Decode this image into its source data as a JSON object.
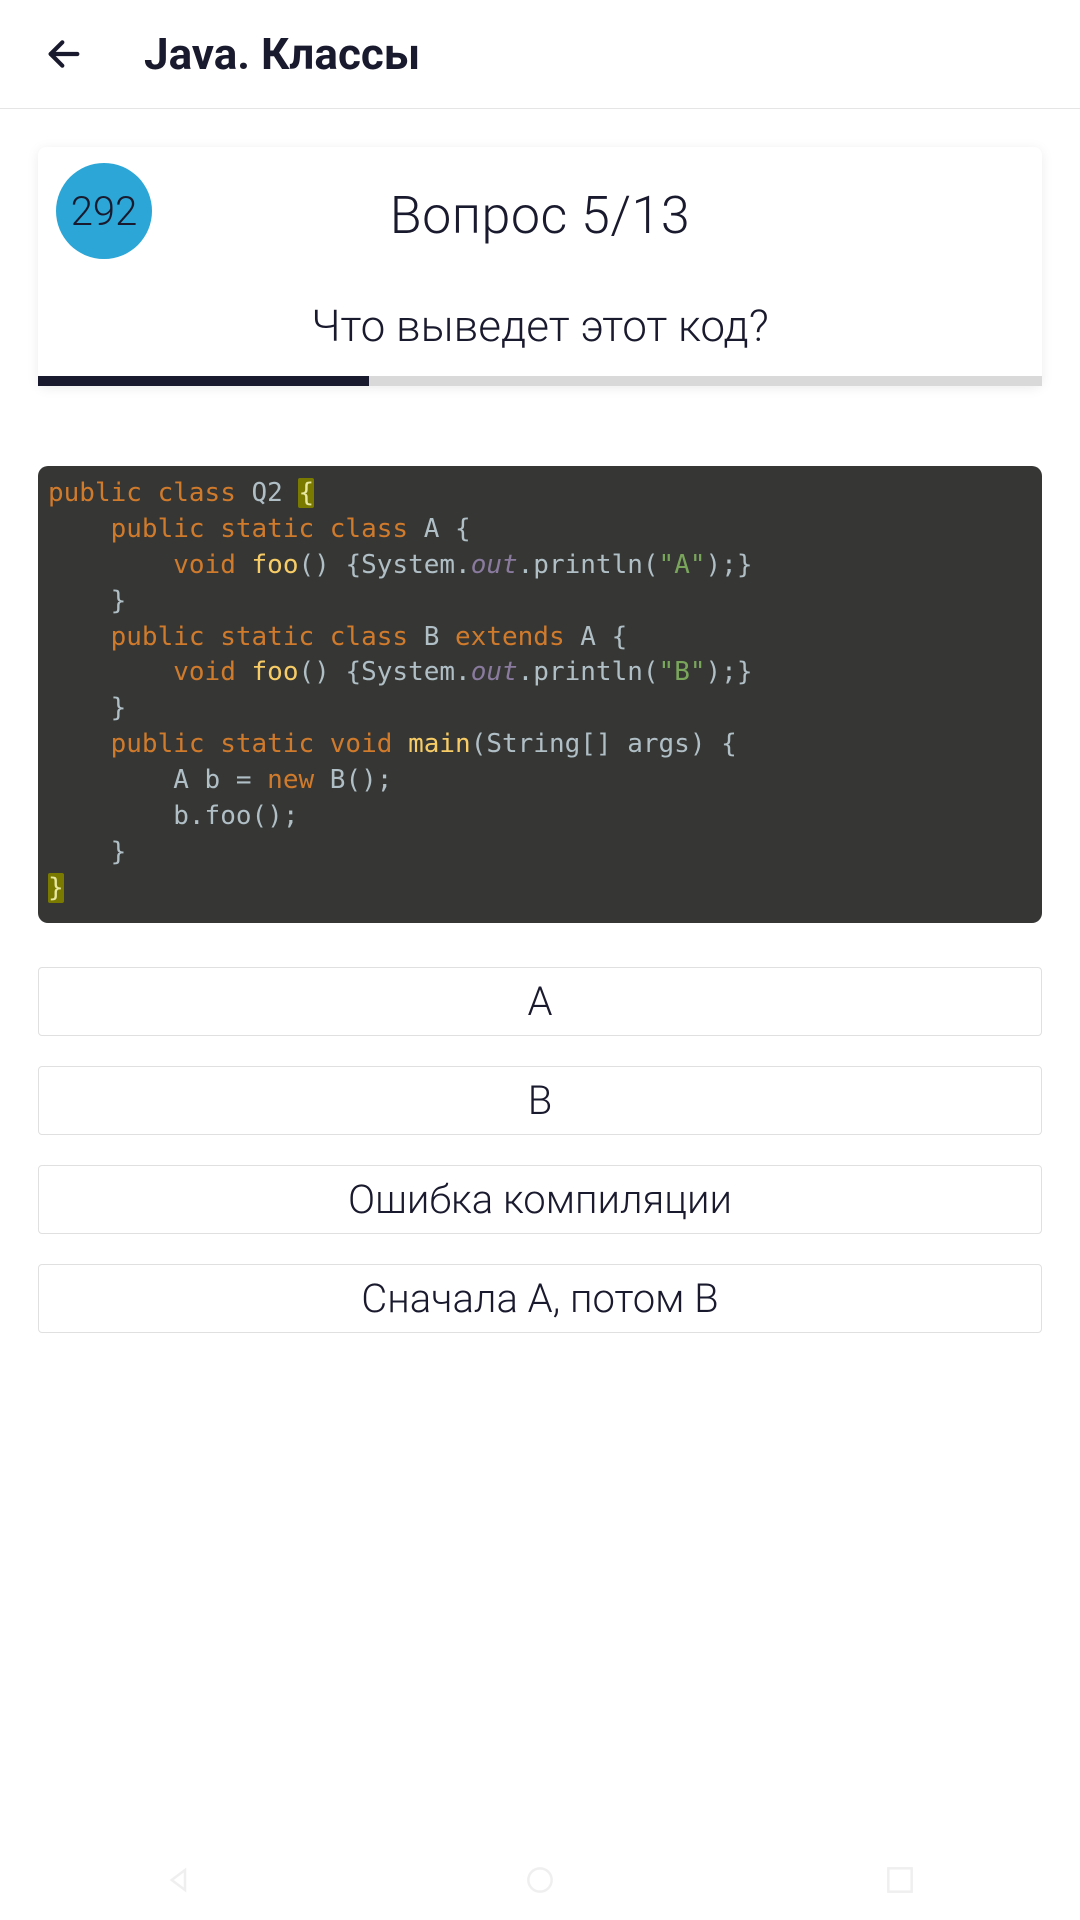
{
  "header": {
    "title": "Java. Классы"
  },
  "card": {
    "badge": "292",
    "question_label": "Вопрос 5/13",
    "question_text": "Что выведет этот код?",
    "progress_percent": 33
  },
  "code": {
    "class_name": "Q2",
    "inner_a": "A",
    "inner_b": "B",
    "method": "foo",
    "main": "main",
    "args": "String[] args",
    "out_a": "\"A\"",
    "out_b": "\"B\"",
    "var_decl": "A b",
    "new_call": "B()",
    "call": "b.foo()"
  },
  "answers": [
    {
      "label": "A"
    },
    {
      "label": "B"
    },
    {
      "label": "Ошибка компиляции"
    },
    {
      "label": "Сначала A, потом B"
    }
  ]
}
